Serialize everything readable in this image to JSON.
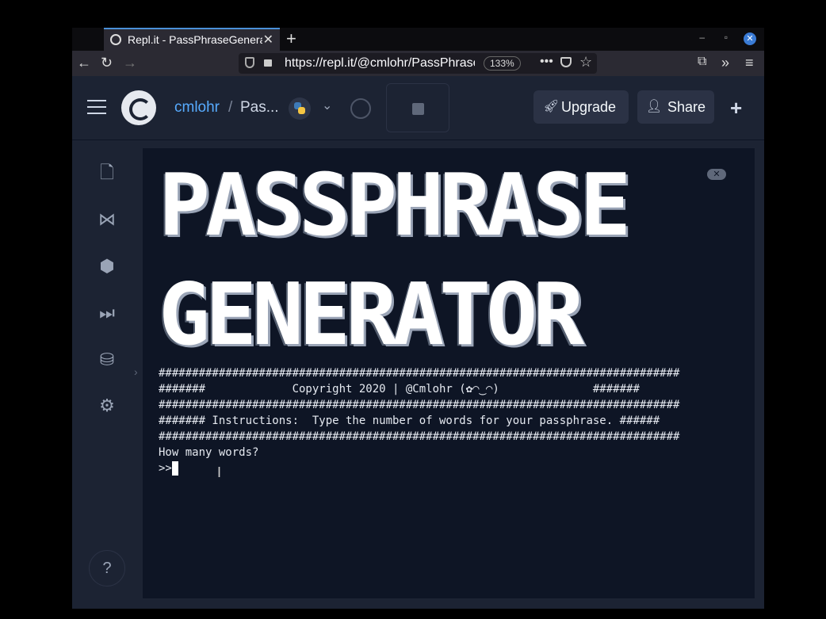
{
  "browser": {
    "tab_title": "Repl.it - PassPhraseGenerator",
    "url": "https://repl.it/@cmlohr/PassPhraseGenerator",
    "zoom": "133%"
  },
  "header": {
    "user": "cmlohr",
    "separator": "/",
    "repo": "Pas...",
    "upgrade_label": "Upgrade",
    "share_label": "Share"
  },
  "sidebar": {
    "items": [
      "file-icon",
      "version-control-icon",
      "packages-icon",
      "debugger-icon",
      "database-icon",
      "settings-icon"
    ],
    "help": "?"
  },
  "console": {
    "banner_line1": "PASSPHRASE",
    "banner_line2": "GENERATOR",
    "lines": [
      "##############################################################################",
      "#######             Copyright 2020 | @Cmlohr (✿◠‿◠)              #######",
      "##############################################################################",
      "####### Instructions:  Type the number of words for your passphrase. ######",
      "##############################################################################",
      "How many words?"
    ],
    "prompt": ">>"
  },
  "colors": {
    "accent": "#57abff",
    "background": "#0e1525",
    "panel": "#1c2333"
  }
}
